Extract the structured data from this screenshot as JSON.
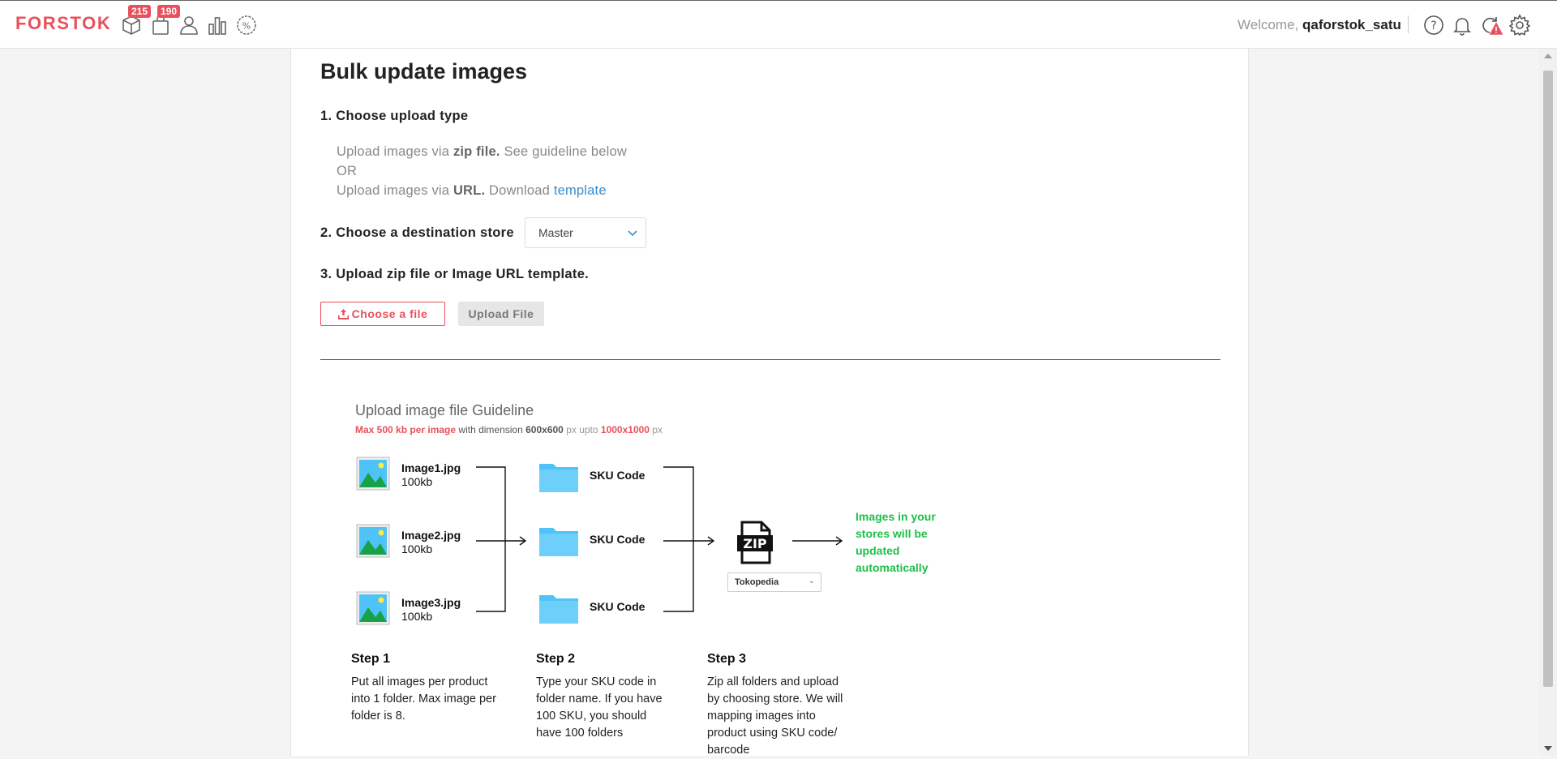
{
  "header": {
    "logo": "FORSTOK",
    "nav": [
      {
        "icon": "box-icon",
        "badge": "215"
      },
      {
        "icon": "shopping-bag-icon",
        "badge": "190"
      },
      {
        "icon": "user-icon",
        "badge": ""
      },
      {
        "icon": "bar-chart-icon",
        "badge": ""
      },
      {
        "icon": "discount-icon",
        "badge": ""
      }
    ],
    "welcome_label": "Welcome,",
    "username": "qaforstok_satu",
    "right_icons": [
      "help-icon",
      "bell-icon",
      "sync-alert-icon",
      "gear-icon"
    ],
    "accent_color": "#e8505b"
  },
  "page": {
    "title": "Bulk update images",
    "step1": {
      "heading": "1. Choose upload type",
      "zip_prefix": "Upload images via",
      "zip_bold": "zip file.",
      "zip_suffix": "See guideline below",
      "or": "OR",
      "url_prefix": "Upload images via",
      "url_bold": "URL.",
      "url_suffix": "Download",
      "url_link": "template"
    },
    "step2": {
      "heading": "2. Choose a destination store",
      "selected_store": "Master"
    },
    "step3": {
      "heading": "3. Upload zip file or Image URL template.",
      "choose_label": "Choose a file",
      "upload_label": "Upload File"
    }
  },
  "guideline": {
    "title": "Upload image file Guideline",
    "sub_red1": "Max 500 kb per image",
    "sub_text1": "with dimension",
    "sub_dim1": "600x600",
    "sub_px1": "px upto",
    "sub_dim2": "1000x1000",
    "sub_px2": "px",
    "images": [
      {
        "name": "Image1.jpg",
        "size": "100kb"
      },
      {
        "name": "Image2.jpg",
        "size": "100kb"
      },
      {
        "name": "Image3.jpg",
        "size": "100kb"
      }
    ],
    "folders": [
      "SKU Code",
      "SKU Code",
      "SKU Code"
    ],
    "zip_label": "ZIP",
    "store_select": "Tokopedia",
    "result_text": "Images in your stores will be updated automatically",
    "steps": [
      {
        "title": "Step 1",
        "text": "Put all images per product into 1 folder. Max image per folder is 8."
      },
      {
        "title": "Step 2",
        "text": "Type your SKU code in folder name. If you have 100 SKU, you should have 100 folders"
      },
      {
        "title": "Step 3",
        "text": "Zip all folders and upload by choosing store. We will mapping images into product using SKU code/ barcode"
      }
    ]
  }
}
